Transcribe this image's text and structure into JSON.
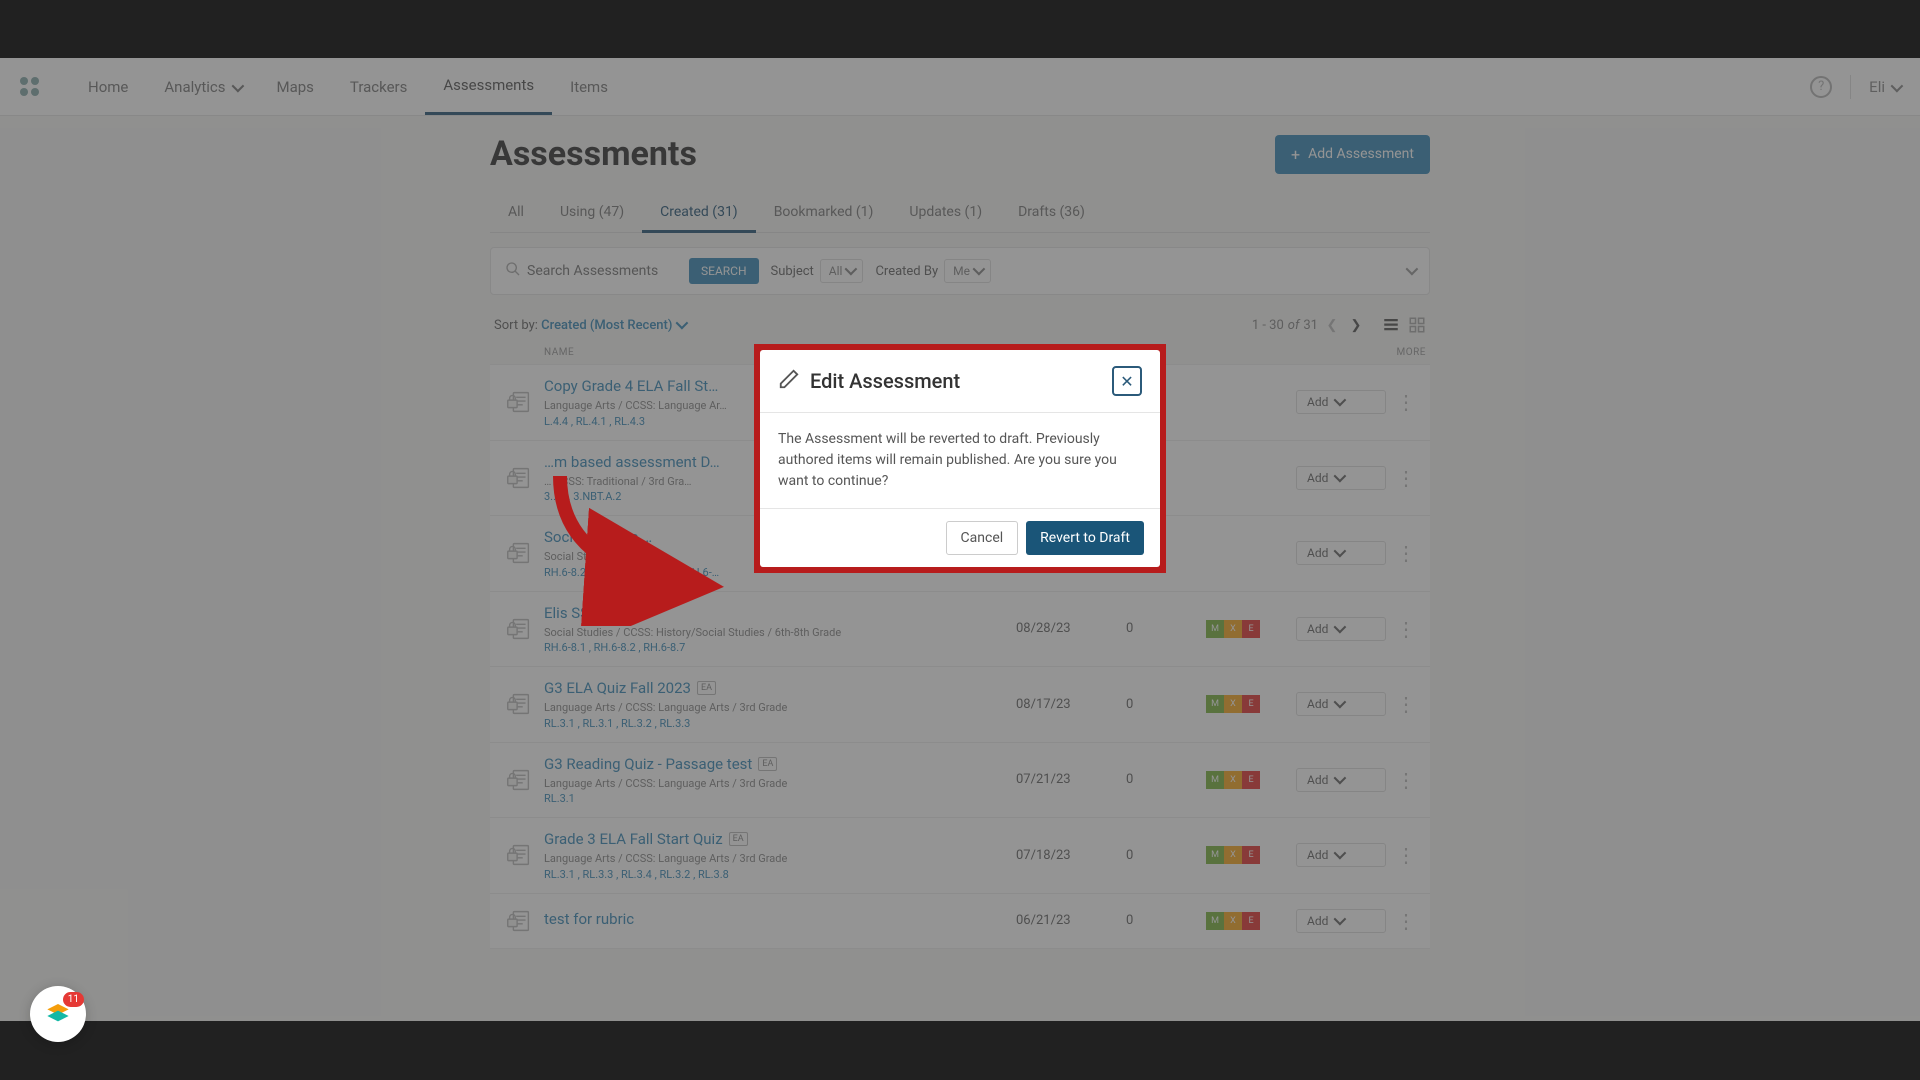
{
  "nav": {
    "items": [
      "Home",
      "Analytics",
      "Maps",
      "Trackers",
      "Assessments",
      "Items"
    ],
    "active": "Assessments",
    "user": "Eli"
  },
  "page": {
    "title": "Assessments",
    "add_button": "Add Assessment"
  },
  "tabs": [
    {
      "label": "All"
    },
    {
      "label": "Using (47)"
    },
    {
      "label": "Created (31)",
      "active": true
    },
    {
      "label": "Bookmarked (1)"
    },
    {
      "label": "Updates (1)"
    },
    {
      "label": "Drafts (36)"
    }
  ],
  "search": {
    "placeholder": "Search Assessments",
    "button": "SEARCH",
    "subject_label": "Subject",
    "subject_value": "All",
    "created_by_label": "Created By",
    "created_by_value": "Me"
  },
  "sort": {
    "label": "Sort by:",
    "value": "Created (Most Recent)",
    "range": "1 - 30",
    "of_label": "of",
    "total": "31"
  },
  "columns": {
    "name": "NAME",
    "more": "MORE"
  },
  "row_add_label": "Add",
  "rows": [
    {
      "name": "Copy Grade 4 ELA Fall St…",
      "meta": "Language Arts  /  CCSS: Language Ar…",
      "stds": "L.4.4 , RL.4.1 , RL.4.3",
      "date": "",
      "count": "",
      "badges": false,
      "ea": false
    },
    {
      "name": "…m based assessment D…",
      "meta": "…  CCSS: Traditional  /  3rd Gra…",
      "stds": "3.…  …  3.NBT.A.2",
      "date": "",
      "count": "",
      "badges": false,
      "ea": false
    },
    {
      "name": "Social Studies …",
      "meta": "Social Studies  /  CCSS: H…",
      "stds": "RH.6-8.2 , RH.6-8.3 , RH.6-…  , RH.6-…",
      "date": "",
      "count": "",
      "badges": false,
      "ea": false
    },
    {
      "name": "Elis SS quiz",
      "meta": "Social Studies  /  CCSS: History/Social Studies  /  6th-8th Grade",
      "stds": "RH.6-8.1 , RH.6-8.2 , RH.6-8.7",
      "date": "08/28/23",
      "count": "0",
      "badges": true,
      "ea": true
    },
    {
      "name": "G3 ELA Quiz Fall 2023",
      "meta": "Language Arts  /  CCSS: Language Arts  /  3rd Grade",
      "stds": "RL.3.1 , RL.3.1 , RL.3.2 , RL.3.3",
      "date": "08/17/23",
      "count": "0",
      "badges": true,
      "ea": true
    },
    {
      "name": "G3 Reading Quiz - Passage test",
      "meta": "Language Arts  /  CCSS: Language Arts  /  3rd Grade",
      "stds": "RL.3.1",
      "date": "07/21/23",
      "count": "0",
      "badges": true,
      "ea": true
    },
    {
      "name": "Grade 3 ELA Fall Start Quiz",
      "meta": "Language Arts  /  CCSS: Language Arts  /  3rd Grade",
      "stds": "RL.3.1 , RL.3.3 , RL.3.4 , RL.3.2 , RL.3.8",
      "date": "07/18/23",
      "count": "0",
      "badges": true,
      "ea": true
    },
    {
      "name": "test for rubric",
      "meta": "",
      "stds": "",
      "date": "06/21/23",
      "count": "0",
      "badges": true,
      "ea": false
    }
  ],
  "modal": {
    "title": "Edit Assessment",
    "body": "The Assessment will be reverted to draft. Previously authored items will remain published. Are you sure you want to continue?",
    "cancel": "Cancel",
    "confirm": "Revert to Draft"
  },
  "float_badge": "11"
}
